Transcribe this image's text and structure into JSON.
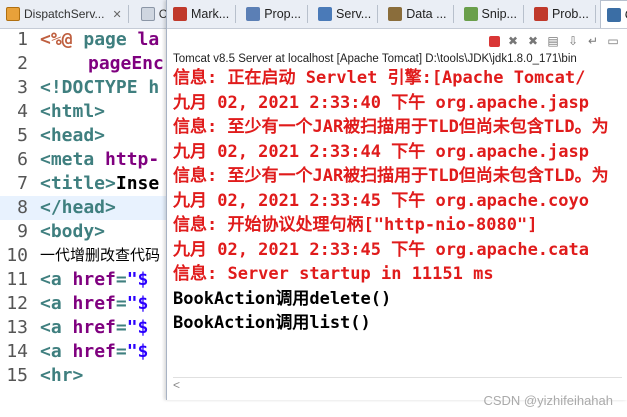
{
  "editor": {
    "tabs": [
      {
        "label": "DispatchServ..."
      },
      {
        "label": "Co"
      }
    ],
    "lines": [
      {
        "num": "1",
        "text": "<%@ page la"
      },
      {
        "num": "2",
        "text": "pageEnc"
      },
      {
        "num": "3",
        "text": "<!DOCTYPE h"
      },
      {
        "num": "4",
        "text": "<html>"
      },
      {
        "num": "5",
        "text": "<head>"
      },
      {
        "num": "6",
        "text": "<meta http-"
      },
      {
        "num": "7",
        "text": "<title>Inse"
      },
      {
        "num": "8",
        "text": "</head>"
      },
      {
        "num": "9",
        "text": "<body>"
      },
      {
        "num": "10",
        "text": "一代增删改查代码"
      },
      {
        "num": "11",
        "text": "<a href=\"$"
      },
      {
        "num": "12",
        "text": "<a href=\"$"
      },
      {
        "num": "13",
        "text": "<a href=\"$"
      },
      {
        "num": "14",
        "text": "<a href=\"$"
      },
      {
        "num": "15",
        "text": "<hr>"
      }
    ]
  },
  "console": {
    "tabs": [
      {
        "label": "Mark...",
        "icon": "markers-icon",
        "color": "#c0392b"
      },
      {
        "label": "Prop...",
        "icon": "properties-icon",
        "color": "#5b7fb5"
      },
      {
        "label": "Serv...",
        "icon": "servers-icon",
        "color": "#4a7ab8"
      },
      {
        "label": "Data ...",
        "icon": "data-source-icon",
        "color": "#8a6d3b"
      },
      {
        "label": "Snip...",
        "icon": "snippets-icon",
        "color": "#6a9f4b"
      },
      {
        "label": "Prob...",
        "icon": "problems-icon",
        "color": "#c0392b"
      },
      {
        "label": "Cons",
        "icon": "console-icon",
        "color": "#3b6ea5"
      }
    ],
    "title": "Tomcat v8.5 Server at localhost [Apache Tomcat] D:\\tools\\JDK\\jdk1.8.0_171\\bin",
    "lines": [
      {
        "text": "信息: 正在启动 Servlet 引擎:[Apache Tomcat/",
        "style": "red"
      },
      {
        "text": "九月 02, 2021 2:33:40 下午 org.apache.jasp",
        "style": "red"
      },
      {
        "text": "信息: 至少有一个JAR被扫描用于TLD但尚未包含TLD。为",
        "style": "red"
      },
      {
        "text": "九月 02, 2021 2:33:44 下午 org.apache.jasp",
        "style": "red"
      },
      {
        "text": "信息: 至少有一个JAR被扫描用于TLD但尚未包含TLD。为",
        "style": "red"
      },
      {
        "text": "九月 02, 2021 2:33:45 下午 org.apache.coyo",
        "style": "red"
      },
      {
        "text": "信息: 开始协议处理句柄[\"http-nio-8080\"]",
        "style": "red"
      },
      {
        "text": "九月 02, 2021 2:33:45 下午 org.apache.cata",
        "style": "red"
      },
      {
        "text": "信息: Server startup in 11151 ms",
        "style": "red"
      },
      {
        "text": "BookAction调用delete()",
        "style": "black"
      },
      {
        "text": "BookAction调用list()",
        "style": "black"
      }
    ]
  },
  "watermark": "CSDN @yizhifeihahah"
}
